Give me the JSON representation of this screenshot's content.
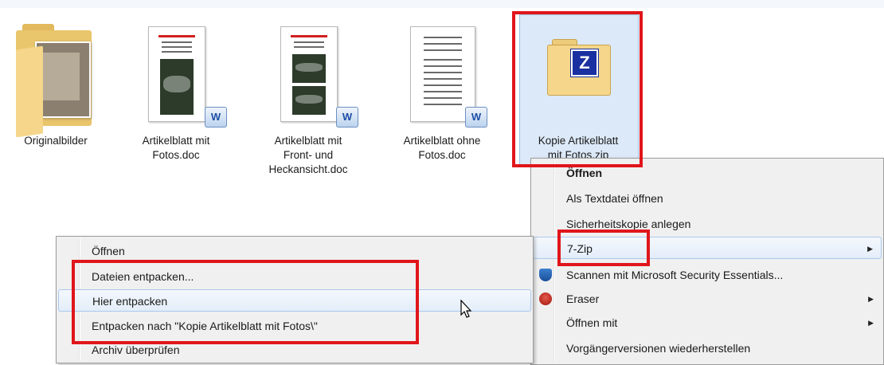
{
  "files": [
    {
      "name": "Originalbilder",
      "lines": [
        "Originalbilder"
      ],
      "type": "folder"
    },
    {
      "name": "Artikelblatt mit Fotos.doc",
      "lines": [
        "Artikelblatt mit",
        "Fotos.doc"
      ],
      "type": "word"
    },
    {
      "name": "Artikelblatt mit Front- und Heckansicht.doc",
      "lines": [
        "Artikelblatt mit",
        "Front- und",
        "Heckansicht.doc"
      ],
      "type": "word"
    },
    {
      "name": "Artikelblatt ohne Fotos.doc",
      "lines": [
        "Artikelblatt ohne",
        "Fotos.doc"
      ],
      "type": "word"
    },
    {
      "name": "Kopie Artikelblatt mit Fotos.zip",
      "lines": [
        "Kopie Artikelblatt",
        "mit Fotos.zip"
      ],
      "type": "7z",
      "selected": true
    }
  ],
  "word_badge_text": "W",
  "zip_badge_text": "Z",
  "main_menu": {
    "items": [
      {
        "label": "Öffnen",
        "bold": true
      },
      {
        "label": "Als Textdatei öffnen"
      },
      {
        "label": "Sicherheitskopie anlegen"
      },
      {
        "label": "7-Zip",
        "submenu": true,
        "highlighted": true
      },
      {
        "label": "Scannen mit Microsoft Security Essentials...",
        "icon": "shield-icon"
      },
      {
        "label": "Eraser",
        "submenu": true,
        "icon": "eraser-icon"
      },
      {
        "label": "Öffnen mit",
        "submenu": true
      },
      {
        "label": "Vorgängerversionen wiederherstellen"
      }
    ]
  },
  "zip_menu": {
    "items": [
      {
        "label": "Öffnen"
      },
      {
        "label": "Dateien entpacken..."
      },
      {
        "label": "Hier entpacken",
        "highlighted": true
      },
      {
        "label": "Entpacken nach \"Kopie Artikelblatt mit Fotos\\\""
      },
      {
        "label": "Archiv überprüfen"
      }
    ]
  },
  "submenu_arrow": "▶",
  "colors": {
    "highlight_red": "#e0161b",
    "selection_blue": "#dce9f8",
    "menu_bg": "#f0f0f0"
  }
}
